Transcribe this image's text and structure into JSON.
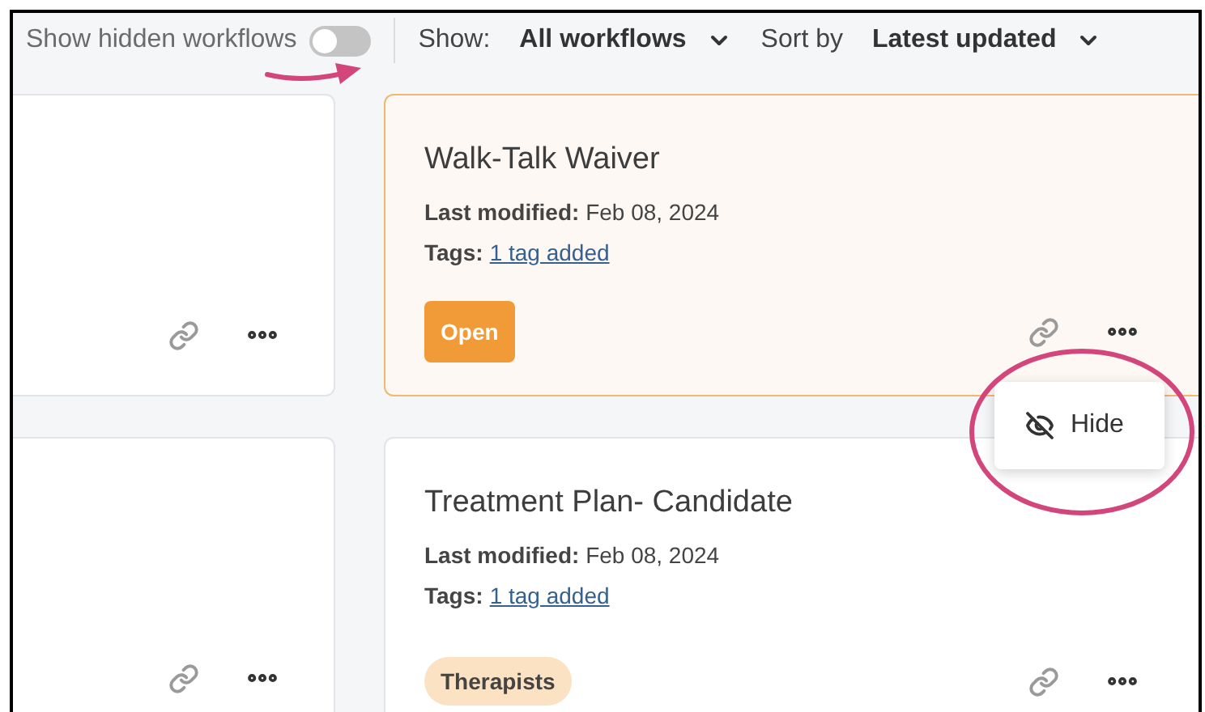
{
  "toolbar": {
    "hidden_label": "Show hidden workflows",
    "hidden_on": false,
    "show_label": "Show:",
    "show_value": "All workflows",
    "sort_label": "Sort by",
    "sort_value": "Latest updated"
  },
  "rows": [
    {
      "left": {
        "kind": "partial"
      },
      "right": {
        "kind": "full",
        "highlighted": true,
        "title": "Walk-Talk Waiver",
        "modified_label": "Last modified:",
        "modified": "Feb 08, 2024",
        "tags_label": "Tags:",
        "tags_link": "1 tag added",
        "action": {
          "kind": "button",
          "label": "Open"
        }
      }
    },
    {
      "left": {
        "kind": "partial"
      },
      "right": {
        "kind": "full",
        "highlighted": false,
        "title": "Treatment Plan- Candidate",
        "modified_label": "Last modified:",
        "modified": "Feb 08, 2024",
        "tags_label": "Tags:",
        "tags_link": "1 tag added",
        "action": {
          "kind": "tag",
          "label": "Therapists"
        }
      }
    }
  ],
  "menu": {
    "items": [
      {
        "label": "Hide"
      }
    ]
  }
}
